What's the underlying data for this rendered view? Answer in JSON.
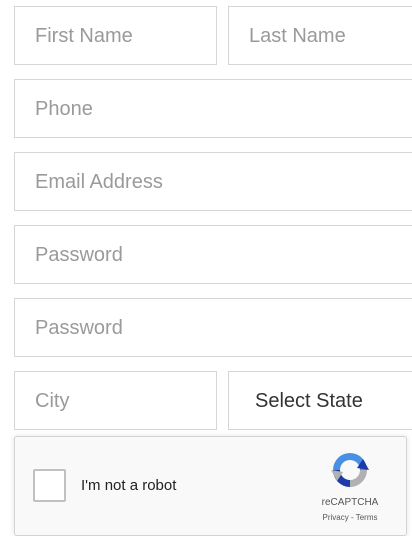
{
  "form": {
    "first_name_placeholder": "First Name",
    "last_name_placeholder": "Last Name",
    "phone_placeholder": "Phone",
    "email_placeholder": "Email Address",
    "password_placeholder": "Password",
    "confirm_password_placeholder": "Password",
    "city_placeholder": "City",
    "state_selected": "Select State"
  },
  "recaptcha": {
    "checkbox_label": "I'm not a robot",
    "brand": "reCAPTCHA",
    "privacy_link": "Privacy",
    "separator": " - ",
    "terms_link": "Terms",
    "logo_icon": "recaptcha-logo-icon",
    "colors": {
      "logo_blue": "#4a90e2",
      "logo_light_blue": "#1c3aa9",
      "logo_gray": "#b1b1b1"
    }
  }
}
